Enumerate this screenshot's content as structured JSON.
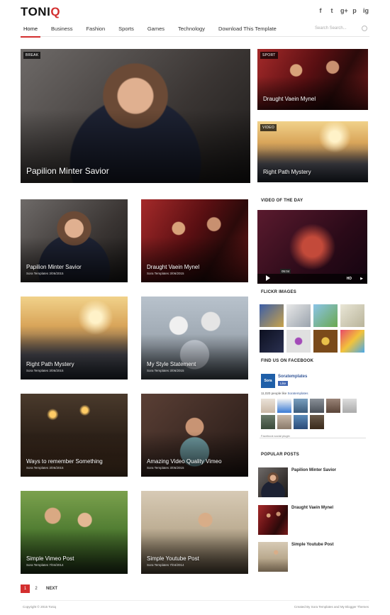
{
  "header": {
    "logo_main": "TONI",
    "logo_accent": "Q",
    "social": [
      "f",
      "t",
      "g+",
      "p",
      "ig"
    ]
  },
  "nav": {
    "items": [
      "Home",
      "Business",
      "Fashion",
      "Sports",
      "Games",
      "Technology",
      "Download This Template"
    ],
    "search_placeholder": "Search Search..."
  },
  "featured": {
    "main": {
      "tag": "BREAK",
      "title": "Papilion Minter Savior"
    },
    "side_top": {
      "tag": "SPORT",
      "title": "Draught Vaein Mynel"
    },
    "side_bottom": {
      "tag": "VIDEO",
      "title": "Right Path Mystery"
    }
  },
  "posts": [
    {
      "title": "Papilion Minter Savior",
      "meta": "Sora Templates  3/06/2015"
    },
    {
      "title": "Draught Vaein Mynel",
      "meta": "Sora Templates  3/06/2015"
    },
    {
      "title": "Right Path Mystery",
      "meta": "Sora Templates  3/06/2015"
    },
    {
      "title": "My Style Statement",
      "meta": "Sora Templates  3/06/2015"
    },
    {
      "title": "Ways to remember Something",
      "meta": "Sora Templates  3/06/2015"
    },
    {
      "title": "Amazing Video Quality Vimeo",
      "meta": "Sora Templates  3/05/2015"
    },
    {
      "title": "Simple Vimeo Post",
      "meta": "Sora Templates  7/04/2014"
    },
    {
      "title": "Simple Youtube Post",
      "meta": "Sora Templates  7/04/2014"
    }
  ],
  "sidebar": {
    "video_title": "VIDEO OF THE DAY",
    "video_time": "05:04",
    "video_hd": "HD",
    "flickr_title": "FLICKR IMAGES",
    "facebook_title": "FIND US ON FACEBOOK",
    "fb_logo": "Sora",
    "fb_name": "Soratemplates",
    "fb_like": "Like",
    "fb_count_prefix": "11,020 people like",
    "fb_count_link": "Soratemplates",
    "fb_plugin": "Facebook social plugin",
    "popular_title": "POPULAR POSTS",
    "popular": [
      "Papilion Minter Savior",
      "Draught Vaein Mynel",
      "Simple Youtube Post"
    ]
  },
  "pagination": {
    "current": "1",
    "next_page": "2",
    "next_label": "NEXT"
  },
  "footer": {
    "left": "Copyright © 2015 Toniq",
    "right": "Created By Sora Templates and My Blogger Themes"
  },
  "colors": {
    "accent": "#d32f2f",
    "facebook": "#365899"
  }
}
